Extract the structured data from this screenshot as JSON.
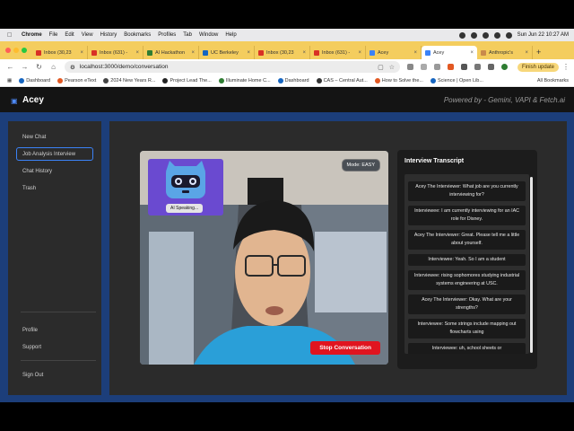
{
  "menubar": {
    "app": "Chrome",
    "items": [
      "File",
      "Edit",
      "View",
      "History",
      "Bookmarks",
      "Profiles",
      "Tab",
      "Window",
      "Help"
    ],
    "datetime": "Sun Jun 22  10:27 AM"
  },
  "tabs": [
    {
      "label": "Inbox (30,23",
      "color": "#d93025"
    },
    {
      "label": "Inbox (631) -",
      "color": "#d93025"
    },
    {
      "label": "AI Hackathon",
      "color": "#2e7d32"
    },
    {
      "label": "UC Berkeley",
      "color": "#1565c0"
    },
    {
      "label": "Inbox (30,23",
      "color": "#d93025"
    },
    {
      "label": "Inbox (631) -",
      "color": "#d93025"
    },
    {
      "label": "Acey",
      "color": "#3b82f6"
    },
    {
      "label": "Acey",
      "color": "#3b82f6",
      "active": true
    },
    {
      "label": "Anthropic's",
      "color": "#c98a4b"
    }
  ],
  "address": {
    "url": "localhost:3000/demo/conversation",
    "finish_update": "Finish update"
  },
  "bookmarks": {
    "items": [
      "Dashboard",
      "Pearson eText",
      "2024 New Years R...",
      "Project Lead The...",
      "Illuminate Home C...",
      "Dashboard",
      "CAS – Central Aut...",
      "How to Solve the...",
      "Science | Open Lib..."
    ],
    "all": "All Bookmarks"
  },
  "app": {
    "brand": "Acey",
    "powered_by": "Powered by - Gemini, VAPI & Fetch.ai"
  },
  "sidebar": {
    "items": [
      "New Chat",
      "Job Analysis Interview",
      "Chat History",
      "Trash"
    ],
    "active_index": 1,
    "bottom_items": [
      "Profile",
      "Support",
      "Sign Out"
    ]
  },
  "video": {
    "mode": "Mode: EASY",
    "ai_status": "AI Speaking...",
    "stop_label": "Stop Conversation"
  },
  "transcript": {
    "title": "Interview Transcript",
    "messages": [
      "Acey The Interviewer: What job are you currently interviewing for?",
      "Interviewee: I am currently interviewing for an IAC role for Disney.",
      "Acey The Interviewer: Great. Please tell me a little about yourself.",
      "Interviewee: Yeah. So I am a student",
      "Interviewee: rising sophomores studying industrial systems engineering at USC.",
      "Acey The Interviewer: Okay. What are your strengths?",
      "Interviewee: Some strings include mapping out flowcharts using",
      "Interviewee: uh, school sheets or"
    ]
  },
  "colors": {
    "accent": "#3b82f6",
    "stop": "#e0141f",
    "ai_card": "#6a4ad0",
    "app_border": "#1c3e7a"
  }
}
